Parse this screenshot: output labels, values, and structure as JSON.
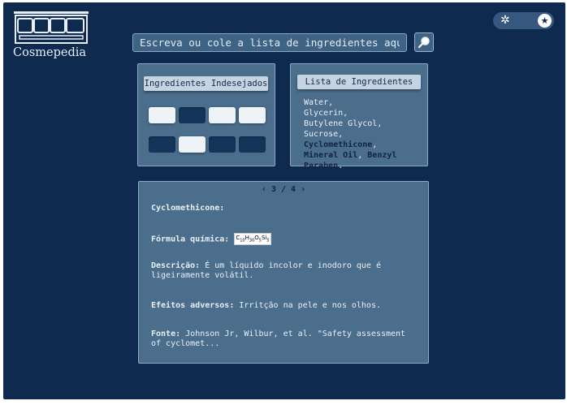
{
  "app": {
    "brand": "Cosmepedia"
  },
  "search": {
    "placeholder": "Escreva ou cole a lista de ingredientes aqui"
  },
  "unwanted_panel": {
    "title": "Ingredientes Indesejados",
    "cells": [
      "filled",
      "empty",
      "filled",
      "filled",
      "empty",
      "filled",
      "empty",
      "empty"
    ]
  },
  "list_panel": {
    "title": "Lista de Ingredientes",
    "items": [
      {
        "text": "Water",
        "flagged": false
      },
      {
        "text": "Glycerin",
        "flagged": false
      },
      {
        "text": "Butylene Glycol",
        "flagged": false
      },
      {
        "text": "Sucrose",
        "flagged": false
      },
      {
        "text": "Cyclomethicone",
        "flagged": true
      },
      {
        "text": "Mineral Oil",
        "flagged": true
      },
      {
        "text": "Benzyl Paraben",
        "flagged": true
      }
    ]
  },
  "detail": {
    "pager": "‹ 3 / 4 ›",
    "name": "Cyclomethicone:",
    "formula_label": "Fórmula química:",
    "formula": {
      "C": "10",
      "H": "30",
      "O": "5",
      "Si": "5"
    },
    "description_label": "Descrição:",
    "description": "É um líquido incolor e inodoro que é ligeiramente volátil.",
    "effects_label": "Efeitos adversos:",
    "effects": "Irritção na pele e nos olhos.",
    "source_label": "Fonte:",
    "source": "Johnson Jr, Wilbur, et al. \"Safety assessment of cyclomet..."
  },
  "theme": {
    "light_icon": "sun-icon",
    "dark_icon": "moon-icon"
  },
  "colors": {
    "background": "#0e2b4f",
    "panel": "#4b6e8d",
    "header": "#c6d4e2"
  }
}
